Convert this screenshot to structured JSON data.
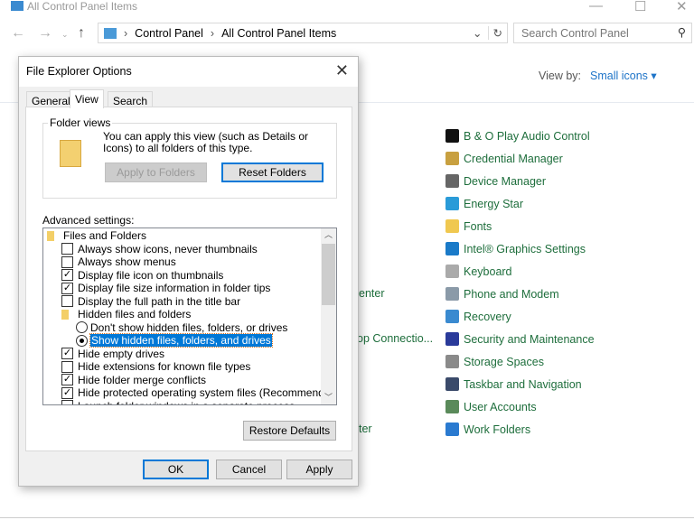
{
  "window": {
    "title": "All Control Panel Items"
  },
  "address": {
    "segments": [
      "Control Panel",
      "All Control Panel Items"
    ]
  },
  "search": {
    "placeholder": "Search Control Panel"
  },
  "view_by": {
    "label": "View by:",
    "value": "Small icons"
  },
  "items": [
    {
      "label": "B & O Play Audio Control",
      "icon": "bo-audio-icon",
      "color": "#111111"
    },
    {
      "label": "Credential Manager",
      "icon": "credential-icon",
      "color": "#c8a040"
    },
    {
      "label": "Device Manager",
      "icon": "device-manager-icon",
      "color": "#666666"
    },
    {
      "label": "Energy Star",
      "icon": "energy-star-icon",
      "color": "#2a9bd8"
    },
    {
      "label": "Fonts",
      "icon": "fonts-icon",
      "color": "#f0c850"
    },
    {
      "label": "Intel® Graphics Settings",
      "icon": "intel-graphics-icon",
      "color": "#1a7ac8"
    },
    {
      "label": "Keyboard",
      "icon": "keyboard-icon",
      "color": "#aaaaaa"
    },
    {
      "label": "Phone and Modem",
      "icon": "phone-modem-icon",
      "color": "#8a9aa8"
    },
    {
      "label": "Recovery",
      "icon": "recovery-icon",
      "color": "#3a8ad0"
    },
    {
      "label": "Security and Maintenance",
      "icon": "flag-icon",
      "color": "#2a3a9a"
    },
    {
      "label": "Storage Spaces",
      "icon": "storage-icon",
      "color": "#8a8a8a"
    },
    {
      "label": "Taskbar and Navigation",
      "icon": "taskbar-icon",
      "color": "#3a4a6a"
    },
    {
      "label": "User Accounts",
      "icon": "users-icon",
      "color": "#5a8a5a"
    },
    {
      "label": "Work Folders",
      "icon": "work-folders-icon",
      "color": "#2a7ad0"
    }
  ],
  "partial_items": [
    "enter",
    "op Connectio...",
    "ter"
  ],
  "dialog": {
    "title": "File Explorer Options",
    "tabs": [
      "General",
      "View",
      "Search"
    ],
    "active_tab": "View",
    "folder_views": {
      "label": "Folder views",
      "text": "You can apply this view (such as Details or Icons) to all folders of this type.",
      "apply": "Apply to Folders",
      "reset": "Reset Folders"
    },
    "advanced_label": "Advanced settings:",
    "settings": [
      {
        "type": "folder",
        "label": "Files and Folders",
        "indent": 0
      },
      {
        "type": "check",
        "label": "Always show icons, never thumbnails",
        "checked": false,
        "indent": 1
      },
      {
        "type": "check",
        "label": "Always show menus",
        "checked": false,
        "indent": 1
      },
      {
        "type": "check",
        "label": "Display file icon on thumbnails",
        "checked": true,
        "indent": 1
      },
      {
        "type": "check",
        "label": "Display file size information in folder tips",
        "checked": true,
        "indent": 1
      },
      {
        "type": "check",
        "label": "Display the full path in the title bar",
        "checked": false,
        "indent": 1
      },
      {
        "type": "folder",
        "label": "Hidden files and folders",
        "indent": 1
      },
      {
        "type": "radio",
        "label": "Don't show hidden files, folders, or drives",
        "checked": false,
        "indent": 2
      },
      {
        "type": "radio",
        "label": "Show hidden files, folders, and drives",
        "checked": true,
        "selected": true,
        "indent": 2
      },
      {
        "type": "check",
        "label": "Hide empty drives",
        "checked": true,
        "indent": 1
      },
      {
        "type": "check",
        "label": "Hide extensions for known file types",
        "checked": false,
        "indent": 1
      },
      {
        "type": "check",
        "label": "Hide folder merge conflicts",
        "checked": true,
        "indent": 1
      },
      {
        "type": "check",
        "label": "Hide protected operating system files (Recommended)",
        "checked": true,
        "indent": 1
      },
      {
        "type": "check",
        "label": "Launch folder windows in a separate process",
        "checked": false,
        "indent": 1
      }
    ],
    "restore": "Restore Defaults",
    "ok": "OK",
    "cancel": "Cancel",
    "apply": "Apply"
  }
}
